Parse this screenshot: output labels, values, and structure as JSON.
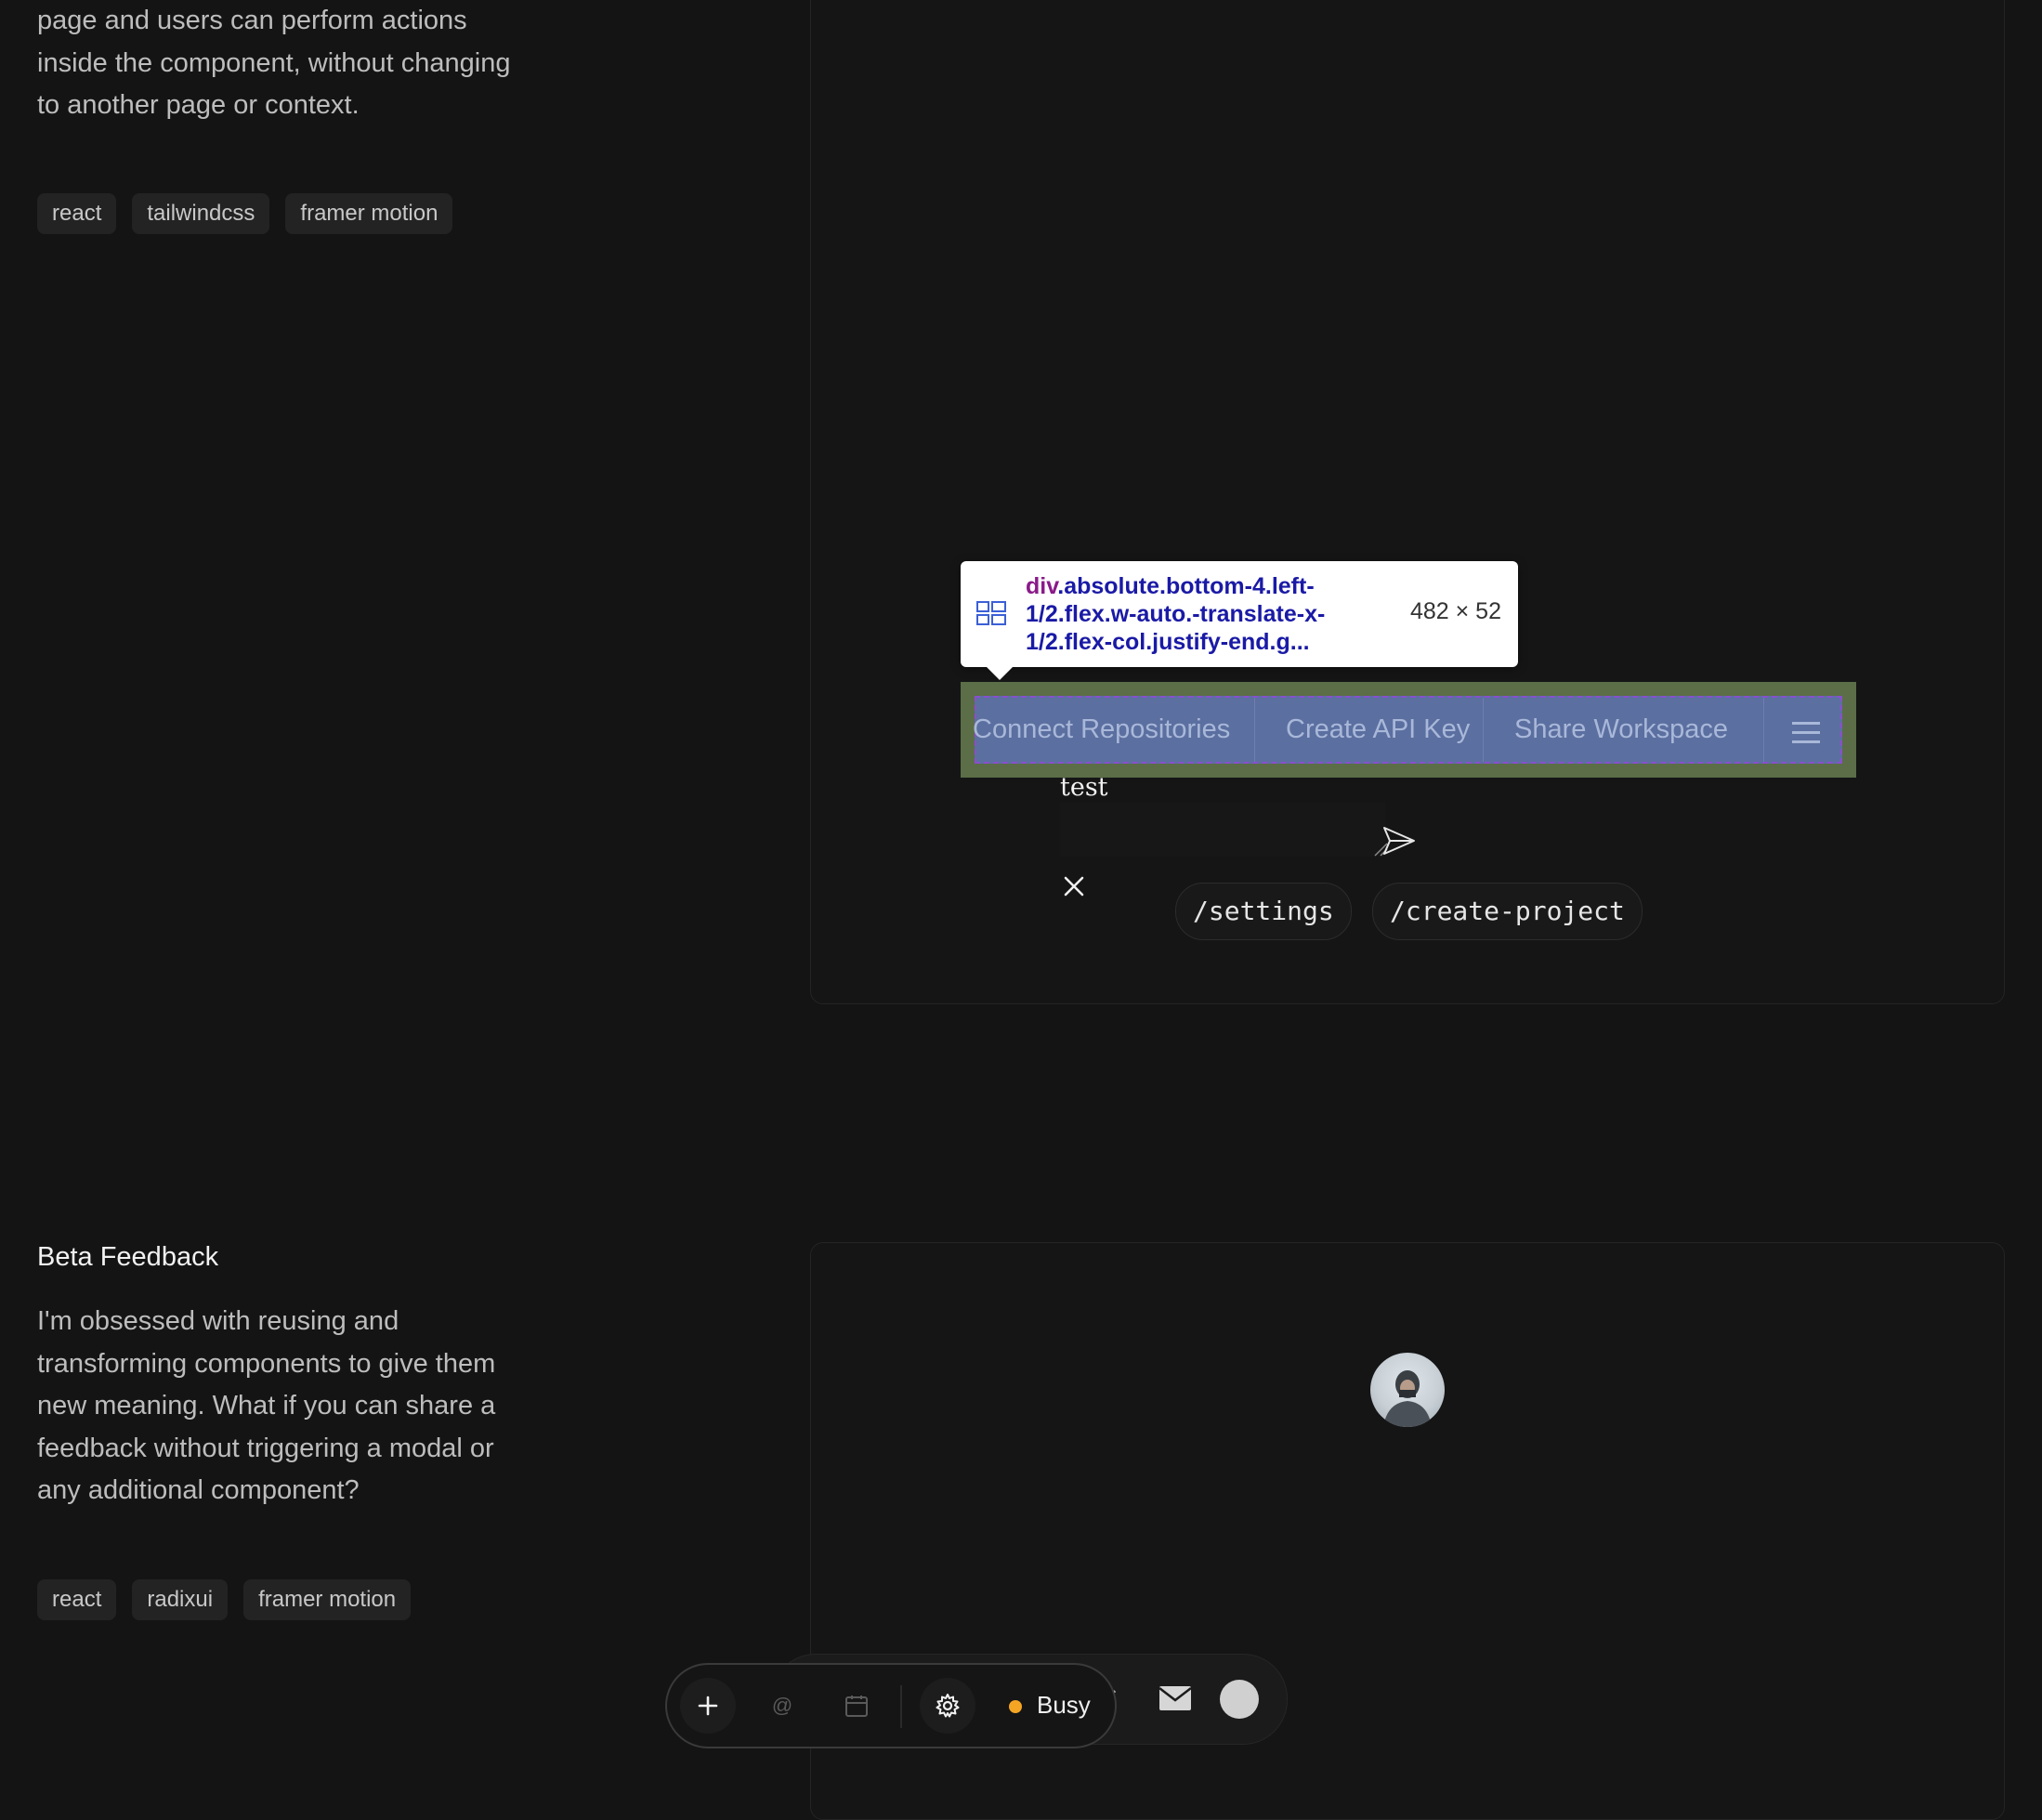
{
  "sections": [
    {
      "description": "page and users can perform actions inside the component, without changing to another page or context.",
      "tags": [
        "react",
        "tailwindcss",
        "framer motion"
      ]
    },
    {
      "title": "Beta Feedback",
      "description": "I'm obsessed with reusing and transforming components to give them new meaning. What if you can share a feedback without triggering a modal or any additional component?",
      "tags": [
        "react",
        "radixui",
        "framer motion"
      ]
    }
  ],
  "inspector": {
    "tag": "div",
    "selector": ".absolute.bottom-4.left-1/2.flex.w-auto.-translate-x-1/2.flex-col.justify-end.g...",
    "size": "482 × 52"
  },
  "nav_bar": {
    "items": [
      "Connect Repositories",
      "Create API Key",
      "Share Workspace"
    ],
    "menu_icon": "hamburger-icon"
  },
  "feedback_widget": {
    "input_value": "test",
    "commands": [
      "/settings",
      "/create-project"
    ],
    "icons": [
      "send-icon",
      "close-icon"
    ]
  },
  "dock": {
    "buttons": [
      "plus-icon",
      "at-icon",
      "calendar-icon",
      "gear-icon"
    ],
    "status_label": "Busy",
    "status_color": "#f5a524",
    "back_icons": [
      "x-logo-icon",
      "mail-icon",
      "avatar-circle"
    ]
  }
}
